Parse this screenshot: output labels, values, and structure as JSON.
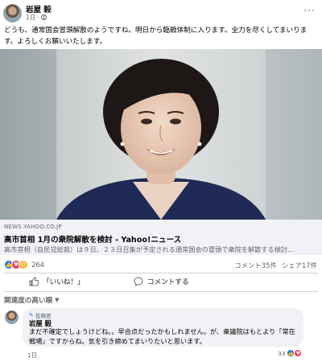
{
  "post": {
    "author": "岩屋 毅",
    "time": "1日",
    "text": "どうも、通常国会冒頭解散のようですね。明日から臨戦体制に入ります。全力を尽くしてまいります。よろしくお願いいたします。"
  },
  "link": {
    "domain": "NEWS.YAHOO.CO.JP",
    "title": "高市首相 1月の衆院解散を検討 - Yahoo!ニュース",
    "description": "高市首相（自民党総裁）は９日、２３日召集が予定される通常国会の冒頭で衆院を解散する検討..."
  },
  "stats": {
    "reaction_count": "264",
    "comments": "コメント35件",
    "shares": "シェア17件"
  },
  "actions": {
    "like_label": "「いいね！」",
    "comment_label": "コメントする"
  },
  "comments": {
    "sort_label": "関連度の高い順"
  },
  "comment": {
    "badge": "投稿者",
    "author": "岩屋 毅",
    "text": "まだ不確定でしょうけどね。。早合点だったかもしれません。が、衆議院はもとより「常在戦場」ですからね。気を引き締めてまいりたいと思います。",
    "time": "1日",
    "reaction_count": "33"
  },
  "icons": {
    "more": "more-horizontal-icon",
    "privacy": "globe-icon",
    "like": "thumbs-up-icon",
    "comment": "comment-bubble-icon",
    "sort": "chevron-down-icon",
    "badge": "author-badge-icon"
  },
  "colors": {
    "accent": "#1877f2",
    "love": "#f33e58",
    "care": "#f7b125",
    "secondary_text": "#65676b",
    "link_box_bg": "#f0f2f5"
  }
}
